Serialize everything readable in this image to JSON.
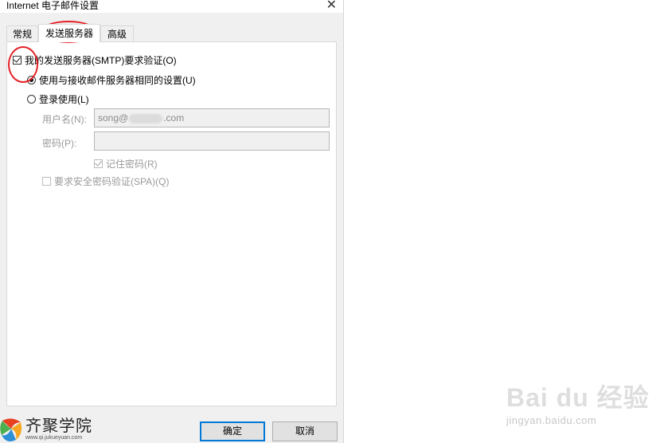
{
  "window": {
    "title": "Internet 电子邮件设置",
    "close_glyph": "✕"
  },
  "tabs": [
    {
      "label": "常规"
    },
    {
      "label": "发送服务器"
    },
    {
      "label": "高级"
    }
  ],
  "smtp_auth": {
    "label": "我的发送服务器(SMTP)要求验证(O)",
    "checked": true
  },
  "options": {
    "same_settings": {
      "label": "使用与接收邮件服务器相同的设置(U)",
      "selected": true
    },
    "login_with": {
      "label": "登录使用(L)",
      "selected": false
    }
  },
  "username": {
    "label": "用户名(N):",
    "value_prefix": "song@",
    "value_suffix": ".com"
  },
  "password": {
    "label": "密码(P):",
    "value": ""
  },
  "remember_password": {
    "label": "记住密码(R)",
    "checked": true
  },
  "spa": {
    "label": "要求安全密码验证(SPA)(Q)",
    "checked": false
  },
  "buttons": {
    "ok": "确定",
    "cancel": "取消"
  },
  "logo": {
    "name": "齐聚学院",
    "url": "www.qi.jukueyuan.com"
  },
  "watermark": {
    "brand": "Bai du 经验",
    "url": "jingyan.baidu.com"
  },
  "annotation_color": "#e32127"
}
